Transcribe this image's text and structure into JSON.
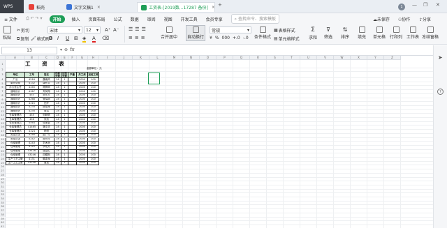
{
  "titlebar": {
    "wps_tab": "WPS",
    "tabs": [
      {
        "label": "稻壳",
        "color": "#e8413a"
      },
      {
        "label": "文字文稿1",
        "color": "#3b74d6",
        "closable": true
      },
      {
        "label": "工资表-[2019数...17287 备份]",
        "color": "#1e9e57",
        "active": true,
        "closable": true
      }
    ],
    "new_tab": "+",
    "user_badge": "1",
    "minimize": "—",
    "restore": "❐",
    "close": "✕"
  },
  "menubar": {
    "file": "≡ 文件",
    "items": [
      "开始",
      "插入",
      "页面布局",
      "公式",
      "数据",
      "审阅",
      "视图",
      "开发工具",
      "会员专享"
    ],
    "search_placeholder": "查找命令、搜索模板",
    "unsaved": "未保存",
    "collab": "协作",
    "share": "分享"
  },
  "toolbar": {
    "paste": "粘贴",
    "cut": "剪切",
    "copy": "复制",
    "format_painter": "格式刷",
    "font_name": "宋体",
    "font_size": "12",
    "bold": "B",
    "italic": "I",
    "underline": "U",
    "grow_font": "A⁺",
    "shrink_font": "A⁻",
    "merge_center": "合并居中",
    "wrap": "自动换行",
    "number_format": "常规",
    "cond_format": "条件格式",
    "table_style": "表格样式",
    "cell_style": "单元格样式",
    "sum": "求和",
    "filter": "筛选",
    "sort": "排序",
    "fill": "填充",
    "cell": "单元格",
    "rowcol": "行和列",
    "worksheet": "工作表",
    "freeze": "冻结窗格"
  },
  "formulabar": {
    "cell_ref": "13",
    "fx": "fx"
  },
  "sheet": {
    "title": "工 资 表",
    "unit_label": "金额单位：元",
    "headers": [
      "单位",
      "工号",
      "姓名",
      "出勤天数",
      "加班天数",
      "产量",
      "月工资",
      "加班工资"
    ],
    "rows": [
      [
        "厂长",
        "4516",
        "魏南风",
        "28",
        "1",
        "",
        "2000",
        "100"
      ],
      [
        "单元总经",
        "4132",
        "唐长文",
        "28",
        "1",
        "",
        "2000",
        "100"
      ],
      [
        "办公室主任",
        "4345",
        "顾佩佩",
        "28",
        "1",
        "",
        "2000",
        "100"
      ],
      [
        "通用设计",
        "4367",
        "郑凤翔",
        "28",
        "1",
        "",
        "2000",
        "100"
      ],
      [
        "通用设计",
        "453",
        "朱东方",
        "28",
        "1",
        "",
        "2000",
        "100"
      ],
      [
        "通用设计",
        "4268",
        "曹瑞刚",
        "28",
        "1",
        "",
        "2000",
        "100"
      ],
      [
        "通用设计",
        "4315",
        "田开",
        "28",
        "1",
        "",
        "2000",
        "100"
      ],
      [
        "通用设计",
        "4234",
        "柳宏博",
        "28",
        "1",
        "",
        "2000",
        "100"
      ],
      [
        "通用设计",
        "4235",
        "单洁",
        "28",
        "1",
        "",
        "2000",
        "100"
      ],
      [
        "仓库管理员",
        "455",
        "何精勇",
        "28",
        "1",
        "",
        "2000",
        "100"
      ],
      [
        "仓库管理员",
        "456",
        "张凯",
        "28",
        "1",
        "",
        "2000",
        "100"
      ],
      [
        "仓库管理员",
        "4564",
        "徐家豪",
        "28",
        "1",
        "",
        "2000",
        "100"
      ],
      [
        "仓库管理员",
        "41465",
        "蒋中华",
        "28",
        "1",
        "",
        "2000",
        "100"
      ],
      [
        "仓库管理员",
        "4324",
        "杨恒",
        "28",
        "1",
        "",
        "2000",
        "100"
      ],
      [
        "安全员张",
        "4246",
        "赵广行",
        "28",
        "1",
        "",
        "2000",
        "100"
      ],
      [
        "安全员张",
        "4242",
        "顾可可",
        "28",
        "1",
        "",
        "2000",
        "100"
      ],
      [
        "仓库管理",
        "4243",
        "刘木洲",
        "28",
        "1",
        "",
        "2000",
        "100"
      ],
      [
        "仓库管理",
        "4125",
        "李佑天",
        "28",
        "1",
        "",
        "2000",
        "100"
      ],
      [
        "仓库管理",
        "43426",
        "楼嘉伦",
        "28",
        "1",
        "",
        "2000",
        "100"
      ],
      [
        "仓库管理",
        "43246",
        "四耀阳",
        "28",
        "1",
        "",
        "2000",
        "100"
      ],
      [
        "生产工艺主管",
        "4131",
        "韩金龙",
        "28",
        "1",
        "",
        "2000",
        "100"
      ],
      [
        "生产工艺主管",
        "43246",
        "唐龙",
        "28",
        "1",
        "",
        "2000",
        "100"
      ]
    ],
    "row_numbers": [
      "1",
      "2",
      "3",
      "4",
      "5",
      "6",
      "7",
      "8",
      "9",
      "10",
      "11",
      "12",
      "13",
      "14",
      "15",
      "16",
      "17",
      "18",
      "19",
      "20",
      "21",
      "22",
      "23",
      "24",
      "25",
      "26",
      "27",
      "28",
      "29",
      "30",
      "31",
      "32",
      "33",
      "34",
      "35",
      "36",
      "37",
      "38",
      "39",
      "40",
      "41"
    ],
    "col_letters": [
      "A",
      "B",
      "C",
      "D",
      "E",
      "F",
      "G",
      "H",
      "I",
      "J",
      "K",
      "L",
      "M",
      "N",
      "O",
      "P",
      "Q",
      "R",
      "S",
      "T",
      "U",
      "V",
      "W",
      "X",
      "Y",
      "Z"
    ]
  },
  "right_panel": {
    "cursor_icon": "cursor-icon",
    "help_icon": "help-icon"
  }
}
